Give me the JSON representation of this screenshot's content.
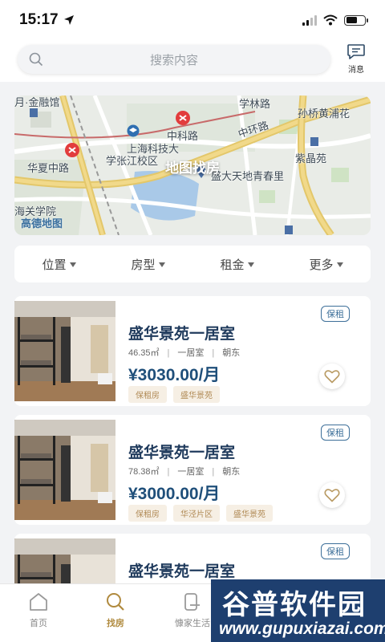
{
  "status_bar": {
    "time": "15:17"
  },
  "header": {
    "search_placeholder": "搜索内容",
    "message_label": "消息"
  },
  "map": {
    "title": "地图找房",
    "labels": [
      "学林路",
      "孙桥黄浦花",
      "中科路",
      "中环路",
      "上海科技大",
      "学张江校区",
      "华夏中路",
      "紫晶苑",
      "盛大天地青春里",
      "海关学院",
      "月·金融馆"
    ],
    "attribution": "高德地图"
  },
  "filters": [
    {
      "label": "位置"
    },
    {
      "label": "房型"
    },
    {
      "label": "租金"
    },
    {
      "label": "更多"
    }
  ],
  "listings": [
    {
      "title": "盛华景苑一居室",
      "area": "46.35㎡",
      "layout": "一居室",
      "orientation": "朝东",
      "price": "¥3030.00/月",
      "tags": [
        "保租房",
        "盛华景苑"
      ],
      "badge": "保租"
    },
    {
      "title": "盛华景苑一居室",
      "area": "78.38㎡",
      "layout": "一居室",
      "orientation": "朝东",
      "price": "¥3000.00/月",
      "tags": [
        "保租房",
        "华泾片区",
        "盛华景苑"
      ],
      "badge": "保租"
    },
    {
      "title": "盛华景苑一居室",
      "area": "",
      "layout": "",
      "orientation": "",
      "price": "",
      "tags": [],
      "badge": "保租"
    }
  ],
  "tabbar": [
    {
      "label": "首页",
      "icon": "home-icon"
    },
    {
      "label": "找房",
      "icon": "search-icon",
      "active": true
    },
    {
      "label": "慷家生活",
      "icon": "life-icon"
    }
  ],
  "watermark": {
    "line1": "谷普软件园",
    "line2": "www.gupuxiazai.com"
  },
  "colors": {
    "accent_gold": "#b08a3e",
    "title_blue": "#1f3a5c",
    "price_blue": "#1f4f7a",
    "badge_blue": "#3d6f99",
    "tag_bg": "#f6efe4"
  }
}
